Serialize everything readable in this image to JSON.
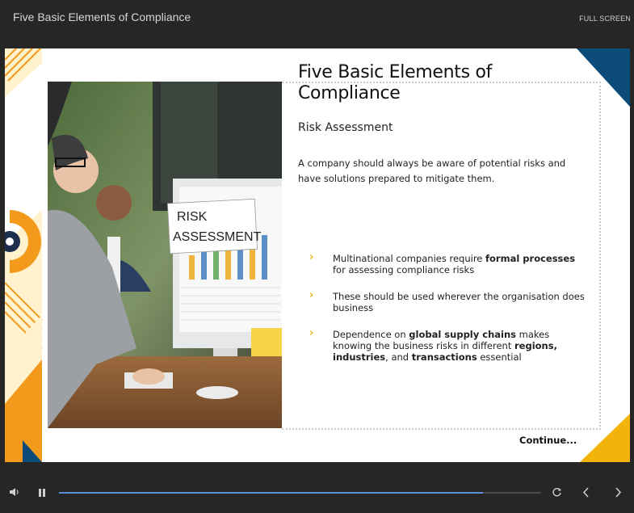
{
  "header": {
    "course_title": "Five Basic Elements of Compliance",
    "fullscreen_label": "FULL SCREEN"
  },
  "slide": {
    "title": "Five Basic Elements of Compliance",
    "subtitle": "Risk Assessment",
    "intro": "A company should always be aware of potential risks and have solutions prepared to mitigate them.",
    "image_sign_line1": "RISK",
    "image_sign_line2": "ASSESSMENT",
    "bullets": [
      {
        "pre": "Multinational companies require ",
        "b1": "formal processes",
        "mid": " for assessing compliance risks",
        "b2": "",
        "mid2": "",
        "b3": "",
        "post": ""
      },
      {
        "pre": "These should be used wherever the organisation does business",
        "b1": "",
        "mid": "",
        "b2": "",
        "mid2": "",
        "b3": "",
        "post": ""
      },
      {
        "pre": "Dependence on ",
        "b1": "global supply chains",
        "mid": " makes knowing the business risks in different ",
        "b2": "regions, industries",
        "mid2": ", and ",
        "b3": "transactions",
        "post": " essential"
      }
    ],
    "continue_label": "Continue..."
  },
  "player": {
    "progress_fraction": 0.88,
    "icons": [
      "volume-icon",
      "pause-icon",
      "replay-icon",
      "previous-icon",
      "next-icon"
    ]
  },
  "colors": {
    "background": "#262626",
    "accent_yellow": "#f2b40a",
    "accent_orange": "#f39a1d",
    "accent_navy": "#0c4a7a",
    "progress": "#5b8ed6"
  }
}
